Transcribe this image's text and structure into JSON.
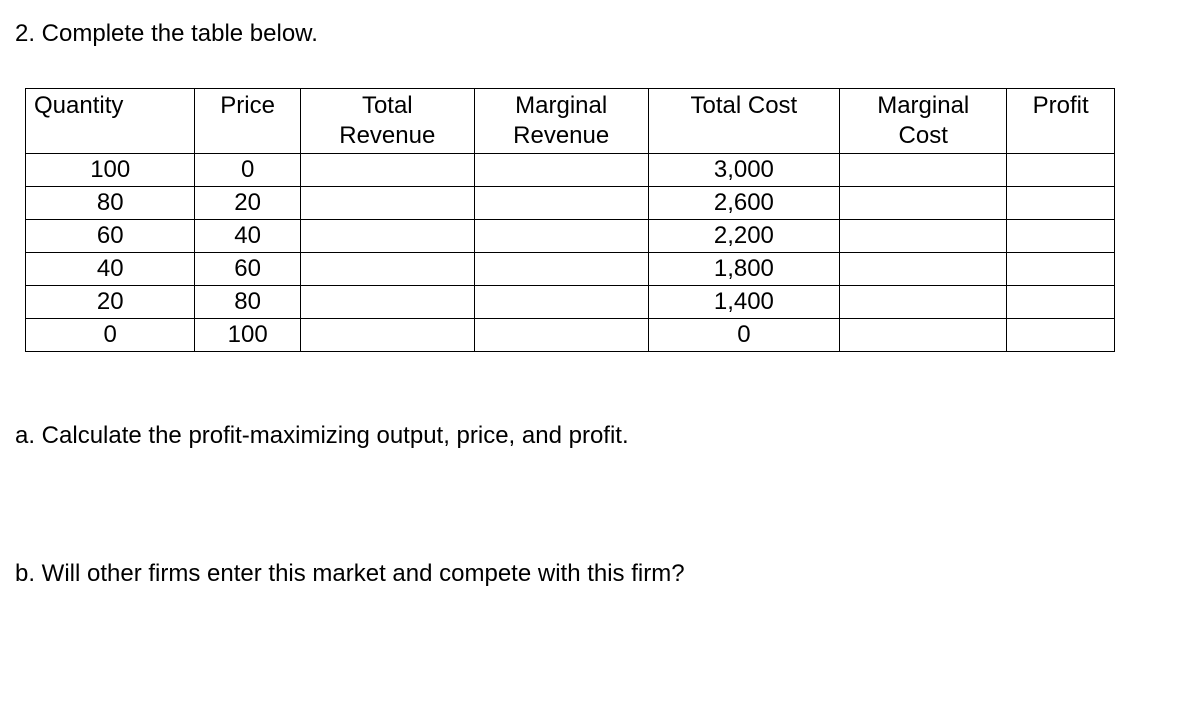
{
  "title": "2. Complete the table below.",
  "headers": {
    "c0": "Quantity",
    "c1": "Price",
    "c2": "Total Revenue",
    "c3": "Marginal Revenue",
    "c4": "Total Cost",
    "c5": "Marginal Cost",
    "c6": "Profit"
  },
  "rows": [
    {
      "quantity": "100",
      "price": "0",
      "total_revenue": "",
      "marginal_revenue": "",
      "total_cost": "3,000",
      "marginal_cost": "",
      "profit": ""
    },
    {
      "quantity": "80",
      "price": "20",
      "total_revenue": "",
      "marginal_revenue": "",
      "total_cost": "2,600",
      "marginal_cost": "",
      "profit": ""
    },
    {
      "quantity": "60",
      "price": "40",
      "total_revenue": "",
      "marginal_revenue": "",
      "total_cost": "2,200",
      "marginal_cost": "",
      "profit": ""
    },
    {
      "quantity": "40",
      "price": "60",
      "total_revenue": "",
      "marginal_revenue": "",
      "total_cost": "1,800",
      "marginal_cost": "",
      "profit": ""
    },
    {
      "quantity": "20",
      "price": "80",
      "total_revenue": "",
      "marginal_revenue": "",
      "total_cost": "1,400",
      "marginal_cost": "",
      "profit": ""
    },
    {
      "quantity": "0",
      "price": "100",
      "total_revenue": "",
      "marginal_revenue": "",
      "total_cost": "0",
      "marginal_cost": "",
      "profit": ""
    }
  ],
  "sub_a": "a. Calculate the profit-maximizing output, price, and profit.",
  "sub_b": "b. Will other firms enter this market and compete with this firm?"
}
